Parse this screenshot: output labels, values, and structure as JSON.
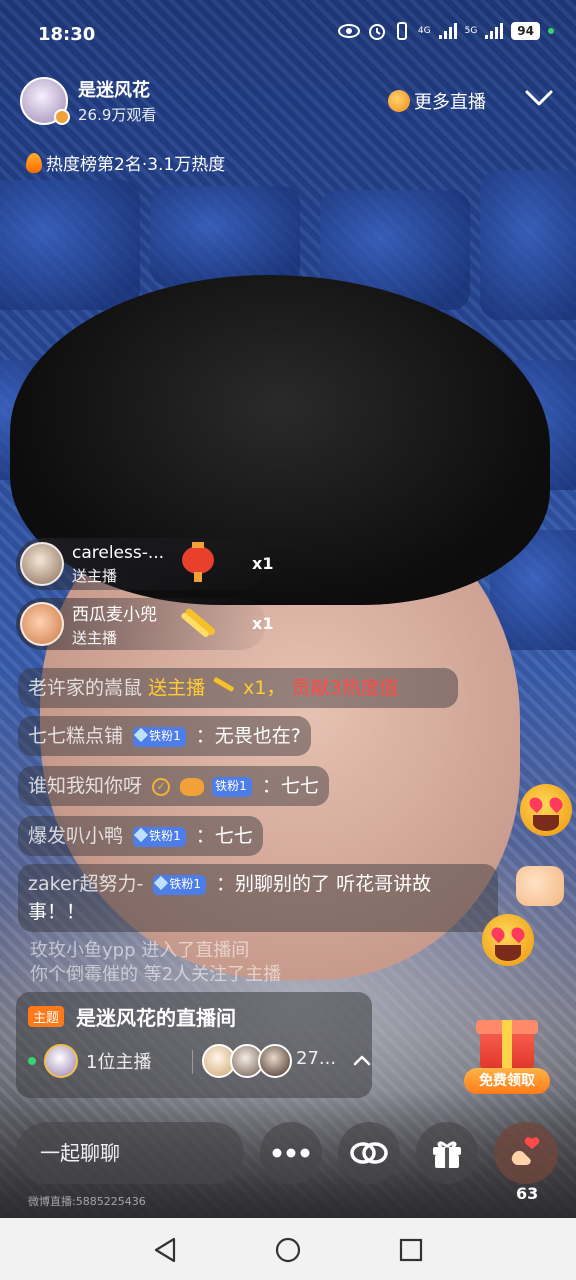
{
  "status_bar": {
    "time": "18:30",
    "network_1": "4G",
    "network_2": "5G",
    "battery": "94"
  },
  "host": {
    "name": "是迷风花",
    "viewers": "26.9万观看"
  },
  "more_live": "更多直播",
  "heat_rank": "热度榜第2名·3.1万热度",
  "gift_notifications": [
    {
      "user": "careless-...",
      "action": "送主播",
      "count": "x1"
    },
    {
      "user": "西瓜麦小兜",
      "action": "送主播",
      "count": "x1"
    }
  ],
  "chat": {
    "gift_row": {
      "user": "老许家的嵩鼠",
      "gift": "送主播",
      "count": "x1，",
      "heat": "贡献3热度值"
    },
    "messages": [
      {
        "user": "七七糕点铺",
        "fan": "铁粉1",
        "text": "：无畏也在?"
      },
      {
        "user": "谁知我知你呀",
        "fan": "铁粉1",
        "text": "：七七"
      },
      {
        "user": "爆发叭小鸭",
        "fan": "铁粉1",
        "text": "：七七"
      },
      {
        "user": "zaker超努力-",
        "fan": "铁粉1",
        "text": "：别聊别的了 听花哥讲故",
        "text2": "事！！"
      }
    ],
    "enter_1": "玫玫小鱼ypp 进入了直播间",
    "enter_2": "你个倒霉催的 等2人关注了主播"
  },
  "room_card": {
    "tag": "主题",
    "title": "是迷风花的直播间",
    "host_count": "1位主播",
    "viewers": "27..."
  },
  "promo": {
    "label": "免费领取"
  },
  "toolbar": {
    "chat_placeholder": "一起聊聊",
    "like_count": "63",
    "watermark": "微博直播:5885225436"
  },
  "colors": {
    "heat_red": "#ff4a4a",
    "gift_yellow": "#ffcc33",
    "fan_badge": "#4d7de8",
    "tag_orange": "#ff7a1a"
  }
}
